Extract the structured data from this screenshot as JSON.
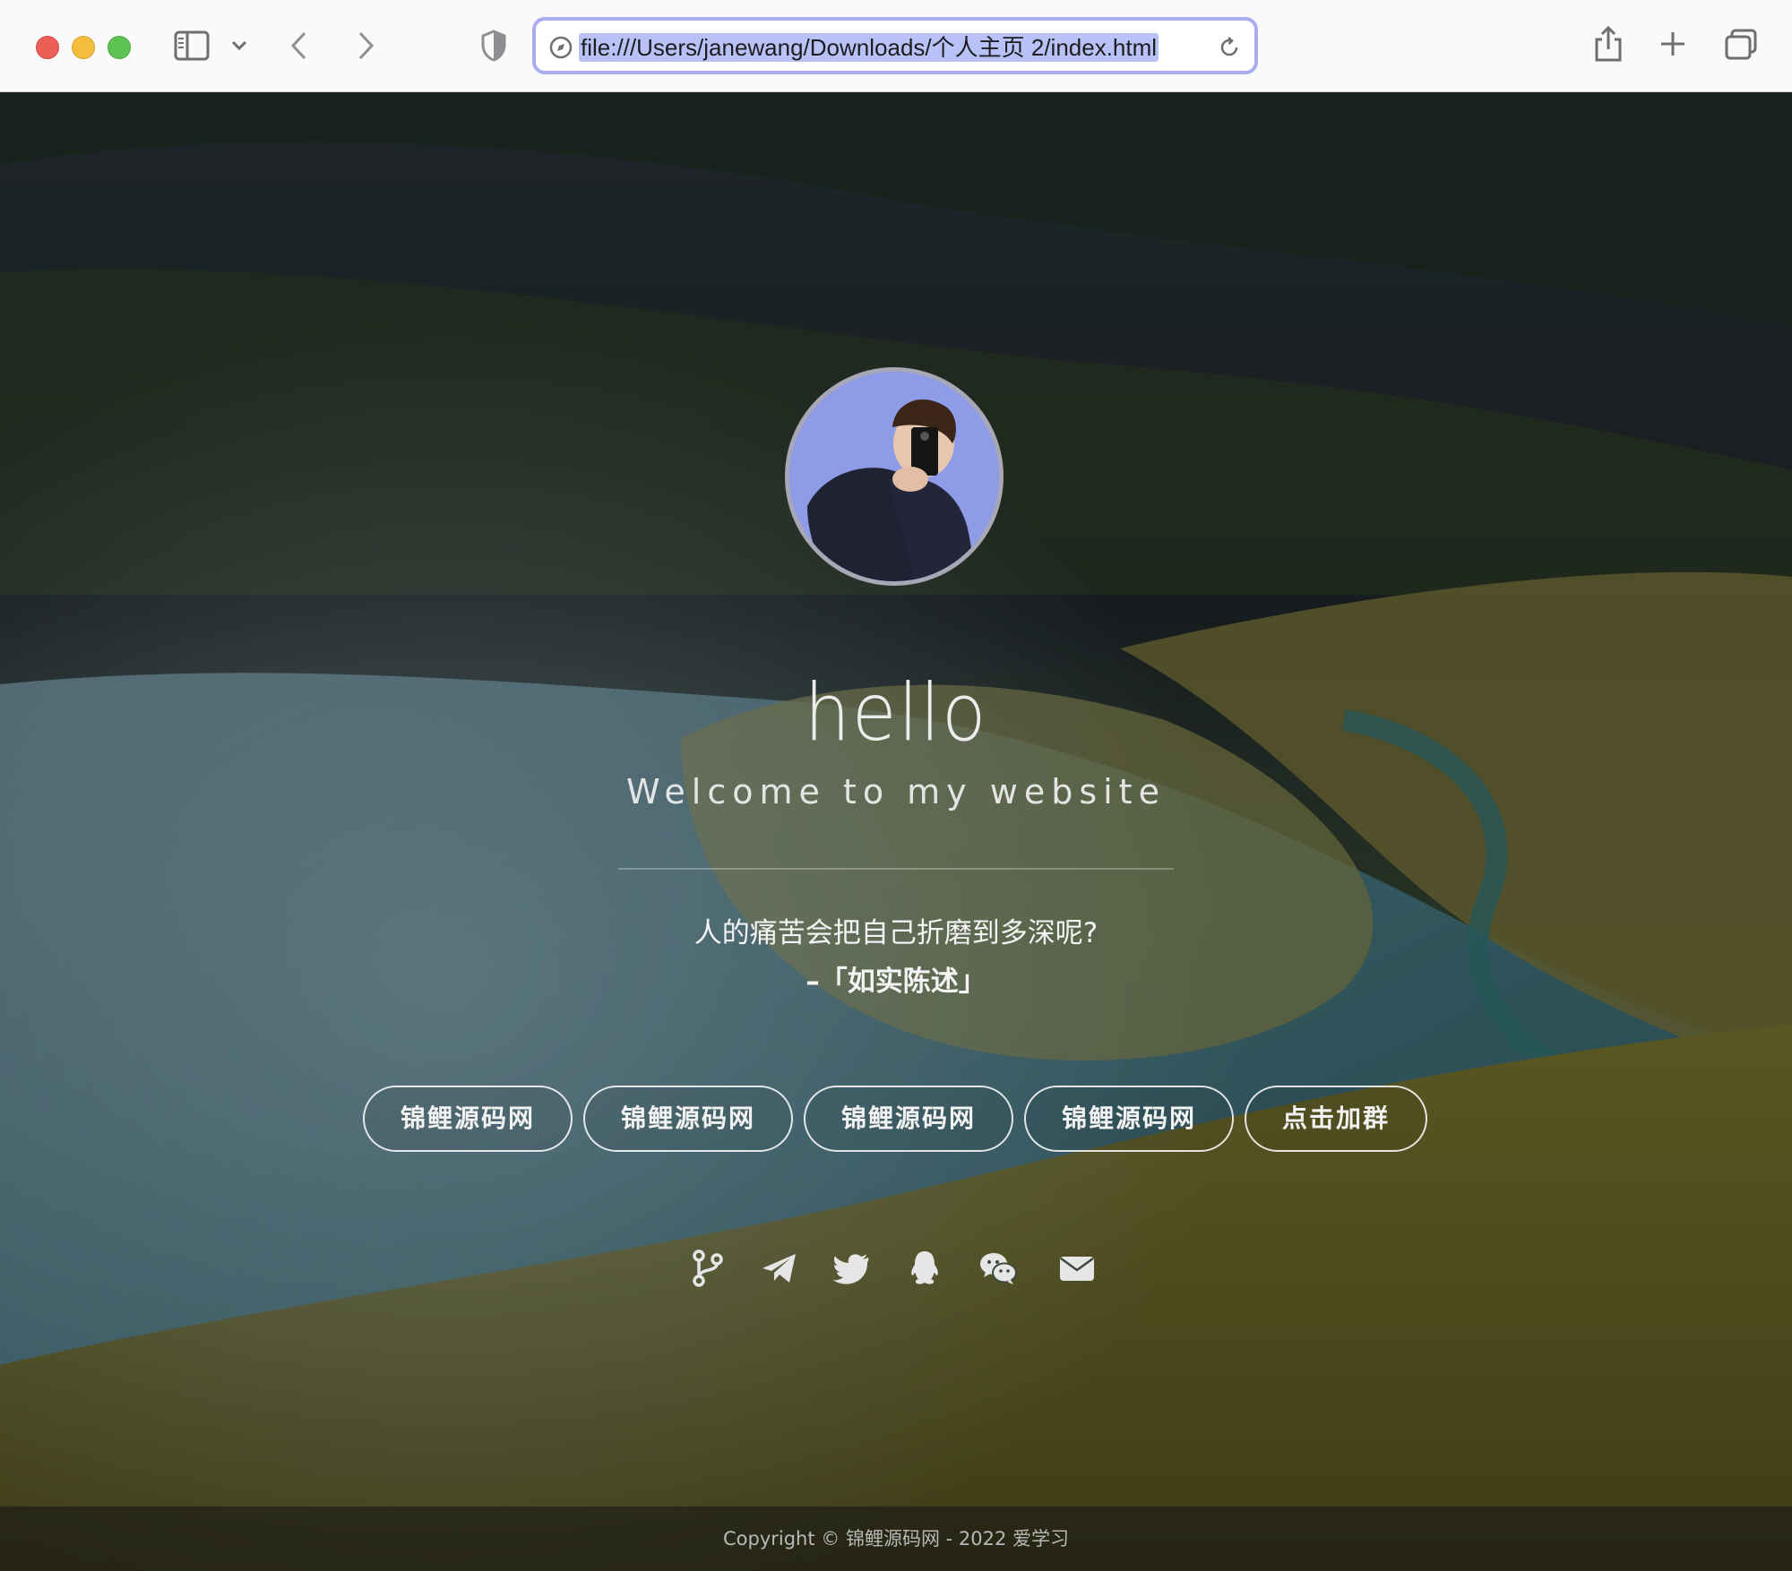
{
  "browser": {
    "url": "file:///Users/janewang/Downloads/个人主页 2/index.html",
    "icons": [
      "sidebar-icon",
      "chevron-down-icon",
      "back-icon",
      "forward-icon",
      "privacy-shield-icon",
      "compass-icon",
      "reload-icon",
      "share-icon",
      "new-tab-icon",
      "tabs-overview-icon"
    ]
  },
  "hero": {
    "title": "hello",
    "subtitle": "Welcome to my website",
    "quote": "人的痛苦会把自己折磨到多深呢?",
    "source": "–「如实陈述」"
  },
  "buttons": [
    {
      "label": "锦鲤源码网"
    },
    {
      "label": "锦鲤源码网"
    },
    {
      "label": "锦鲤源码网"
    },
    {
      "label": "锦鲤源码网"
    },
    {
      "label": "点击加群"
    }
  ],
  "social": [
    "git-branch-icon",
    "telegram-icon",
    "twitter-icon",
    "qq-icon",
    "wechat-icon",
    "mail-icon"
  ],
  "footer": {
    "text": "Copyright © 锦鲤源码网 - 2022 爱学习"
  },
  "colors": {
    "address_focus": "#a9adf0",
    "url_selection": "#b8c2f7",
    "avatar_bg": "#8e9be6",
    "text_light": "#f2f2f2"
  }
}
